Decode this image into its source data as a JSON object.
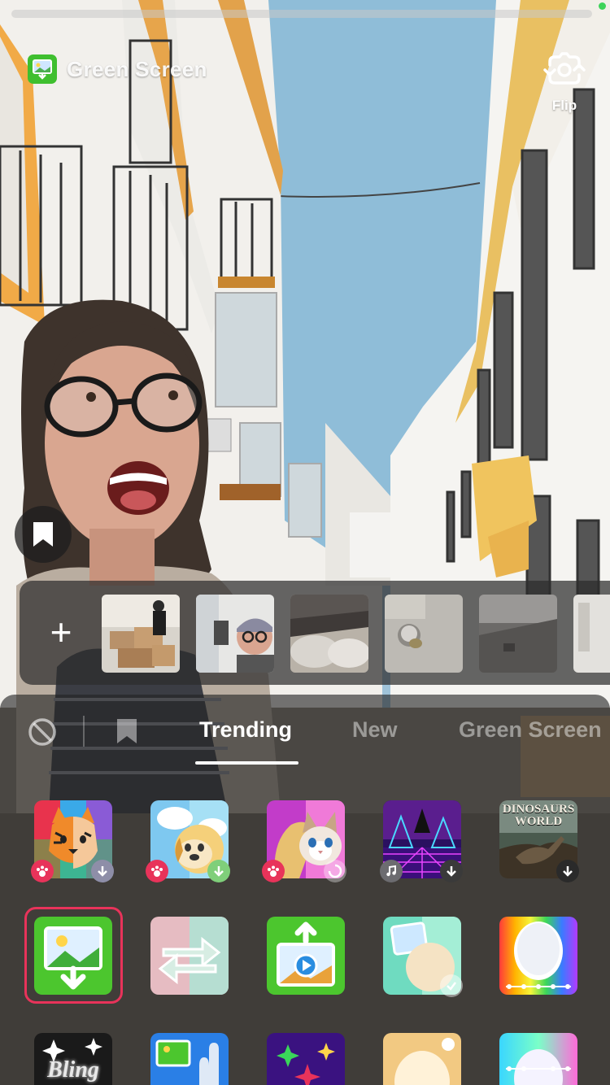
{
  "header": {
    "effect_name": "Green Screen",
    "flip_label": "Flip"
  },
  "gallery": {
    "add_symbol": "+",
    "thumbnails": [
      "photo-boxes",
      "photo-selfie-cap",
      "photo-ottoman",
      "photo-knob",
      "photo-room",
      "photo-window"
    ]
  },
  "effects_panel": {
    "tabs": [
      {
        "label": "Trending",
        "active": true
      },
      {
        "label": "New",
        "active": false
      },
      {
        "label": "Green Screen",
        "active": false
      }
    ],
    "row1": [
      {
        "name": "tiger-face-effect",
        "badge_left": "paw",
        "badge_right": "download"
      },
      {
        "name": "thought-bubble-dog-effect",
        "badge_left": "paw",
        "badge_right": "download"
      },
      {
        "name": "cat-hair-effect",
        "badge_left": "paw",
        "badge_right": "loading"
      },
      {
        "name": "synthwave-effect",
        "badge_left": "music",
        "badge_right": "download"
      },
      {
        "name": "dinosaurs-world-effect",
        "badge_right": "download",
        "text": "DINOSAURS WORLD"
      }
    ],
    "row2": [
      {
        "name": "green-screen-image-effect",
        "selected": true
      },
      {
        "name": "swap-arrows-effect"
      },
      {
        "name": "green-screen-video-effect"
      },
      {
        "name": "photo-face-effect",
        "badge_right": "loading"
      },
      {
        "name": "rainbow-balloon-effect"
      }
    ],
    "row3": [
      {
        "name": "bling-effect",
        "text": "Bling"
      },
      {
        "name": "green-screen-hand-effect"
      },
      {
        "name": "sparkle-stars-effect"
      },
      {
        "name": "glow-face-effect"
      },
      {
        "name": "rainbow-face-effect"
      }
    ]
  },
  "colors": {
    "selection_ring": "#e8335a",
    "tiktok_green": "#3fbf2f",
    "badge_pink": "#e8335a"
  }
}
